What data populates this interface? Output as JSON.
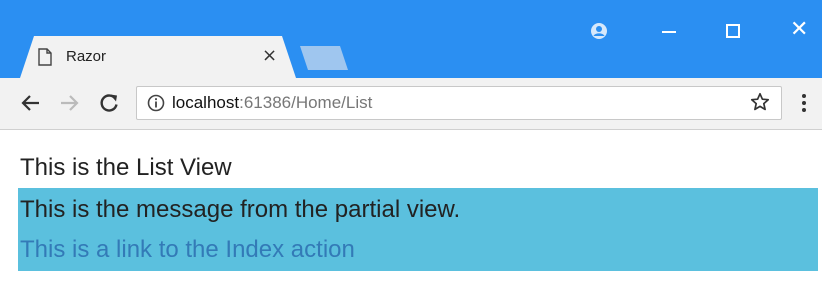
{
  "browser": {
    "tab": {
      "title": "Razor",
      "close_glyph": "×",
      "icon": "page-icon"
    },
    "window_controls": {
      "close_glyph": "✕"
    },
    "address_bar": {
      "host": "localhost",
      "rest": ":61386/Home/List"
    }
  },
  "page": {
    "heading": "This is the List View",
    "partial": {
      "message": "This is the message from the partial view.",
      "link_text": "This is a link to the Index action"
    }
  },
  "colors": {
    "titlebar": "#2b8ff2",
    "partial_background": "#5bc0de",
    "link": "#337ab7"
  }
}
